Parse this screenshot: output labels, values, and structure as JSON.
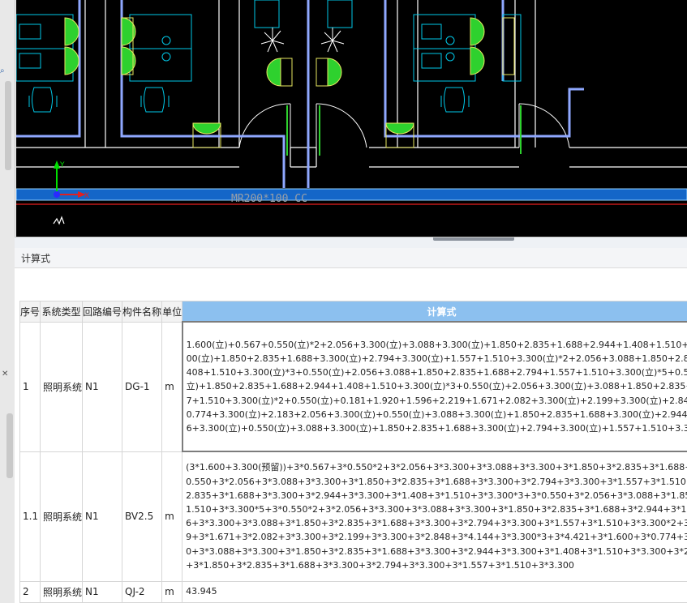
{
  "cad": {
    "duct_label": "MR200*100 CC",
    "axis_y": "Y",
    "axis_x": "X",
    "colors": {
      "background": "#000000",
      "duct": "#1466c8",
      "axis_y": "#00e000",
      "axis_x": "#e02020",
      "fixture_fill": "#2ed12e",
      "furniture": "#00c8e8",
      "wall": "#ffffff"
    }
  },
  "panel": {
    "title": "计算式"
  },
  "table": {
    "headers": [
      "序号",
      "系统类型",
      "回路编号",
      "构件名称",
      "单位",
      "计算式"
    ],
    "rows": [
      {
        "num": "1",
        "system": "照明系统",
        "circuit": "N1",
        "component": "DG-1",
        "unit": "m",
        "formula_lines": [
          "1.600(立)+0.567+0.550(立)*2+2.056+3.300(立)+3.088+3.300(立)+1.850+2.835+1.688+2.944+1.408+1.510+3",
          "00(立)+1.850+2.835+1.688+3.300(立)+2.794+3.300(立)+1.557+1.510+3.300(立)*2+2.056+3.088+1.850+2.83",
          "408+1.510+3.300(立)*3+0.550(立)+2.056+3.088+1.850+2.835+1.688+2.794+1.557+1.510+3.300(立)*5+0.55",
          "立)+1.850+2.835+1.688+2.944+1.408+1.510+3.300(立)*3+0.550(立)+2.056+3.300(立)+3.088+1.850+2.835+",
          "7+1.510+3.300(立)*2+0.550(立)+0.181+1.920+1.596+2.219+1.671+2.082+3.300(立)+2.199+3.300(立)+2.848",
          "0.774+3.300(立)+2.183+2.056+3.300(立)+0.550(立)+3.088+3.300(立)+1.850+2.835+1.688+3.300(立)+2.944+",
          "6+3.300(立)+0.550(立)+3.088+3.300(立)+1.850+2.835+1.688+3.300(立)+2.794+3.300(立)+1.557+1.510+3.30"
        ]
      },
      {
        "num": "1.1",
        "system": "照明系统",
        "circuit": "N1",
        "component": "BV2.5",
        "unit": "m",
        "formula_lines": [
          "(3*1.600+3.300(预留))+3*0.567+3*0.550*2+3*2.056+3*3.300+3*3.088+3*3.300+3*1.850+3*2.835+3*1.688+3",
          "0.550+3*2.056+3*3.088+3*3.300+3*1.850+3*2.835+3*1.688+3*3.300+3*2.794+3*3.300+3*1.557+3*1.510+3",
          "2.835+3*1.688+3*3.300+3*2.944+3*3.300+3*1.408+3*1.510+3*3.300*3+3*0.550+3*2.056+3*3.088+3*1.850",
          "1.510+3*3.300*5+3*0.550*2+3*2.056+3*3.300+3*3.088+3*3.300+3*1.850+3*2.835+3*1.688+3*2.944+3*1.40",
          "6+3*3.300+3*3.088+3*1.850+3*2.835+3*1.688+3*3.300+3*2.794+3*3.300+3*1.557+3*1.510+3*3.300*2+3*0",
          "9+3*1.671+3*2.082+3*3.300+3*2.199+3*3.300+3*2.848+3*4.144+3*3.300*3+3*4.421+3*1.600+3*0.774+3*3",
          "0+3*3.088+3*3.300+3*1.850+3*2.835+3*1.688+3*3.300+3*2.944+3*3.300+3*1.408+3*1.510+3*3.300+3*2.0",
          "+3*1.850+3*2.835+3*1.688+3*3.300+3*2.794+3*3.300+3*1.557+3*1.510+3*3.300"
        ]
      },
      {
        "num": "2",
        "system": "照明系统",
        "circuit": "N1",
        "component": "QJ-2",
        "unit": "m",
        "formula_lines": [
          "43.945"
        ]
      }
    ]
  }
}
